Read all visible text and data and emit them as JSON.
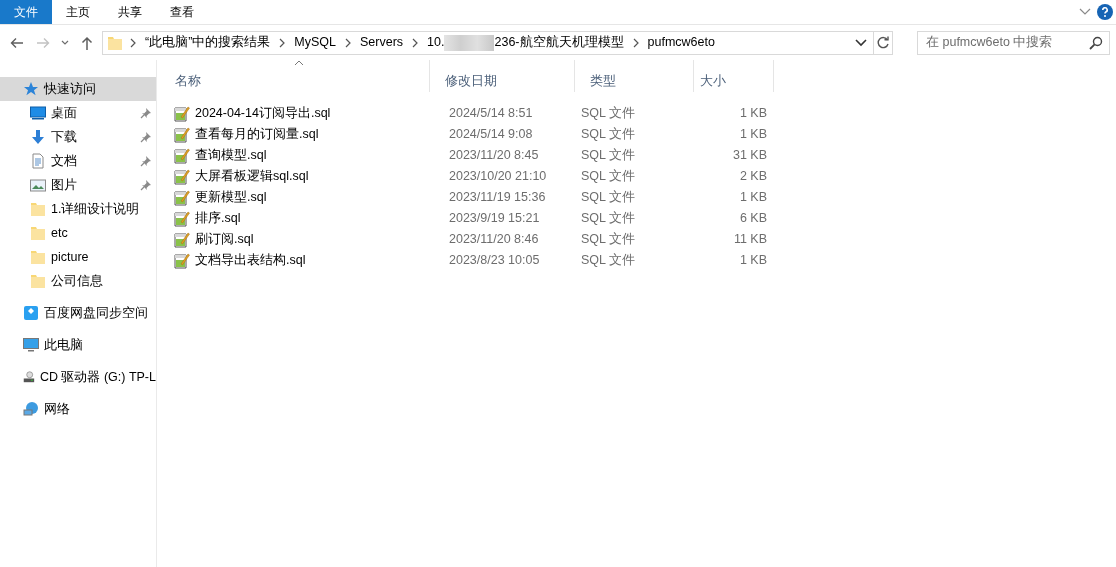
{
  "ribbon": {
    "tabs": [
      {
        "label": "文件",
        "selected": true
      },
      {
        "label": "主页",
        "selected": false
      },
      {
        "label": "共享",
        "selected": false
      },
      {
        "label": "查看",
        "selected": false
      }
    ]
  },
  "address_bar": {
    "segments": [
      {
        "text": "“此电脑”中的搜索结果"
      },
      {
        "text": "MySQL"
      },
      {
        "text": "Servers"
      },
      {
        "text": "10.",
        "redacted": true,
        "text_after": "236-航空航天机理模型"
      },
      {
        "text": "pufmcw6eto"
      }
    ],
    "search": {
      "placeholder": "在 pufmcw6eto 中搜索"
    }
  },
  "sidebar": {
    "items": [
      {
        "label": "快速访问",
        "kind": "quick",
        "selected": true,
        "children": [
          {
            "label": "桌面",
            "kind": "desktop",
            "pinned": true
          },
          {
            "label": "下载",
            "kind": "download",
            "pinned": true
          },
          {
            "label": "文档",
            "kind": "document",
            "pinned": true
          },
          {
            "label": "图片",
            "kind": "pictures",
            "pinned": true
          },
          {
            "label": "1.详细设计说明",
            "kind": "folder",
            "pinned": false
          },
          {
            "label": "etc",
            "kind": "folder",
            "pinned": false
          },
          {
            "label": "picture",
            "kind": "folder",
            "pinned": false
          },
          {
            "label": "公司信息",
            "kind": "folder",
            "pinned": false
          }
        ]
      },
      {
        "label": "百度网盘同步空间",
        "kind": "cloud",
        "selected": false
      },
      {
        "label": "此电脑",
        "kind": "pc",
        "selected": false
      },
      {
        "label": "CD 驱动器 (G:) TP-L",
        "kind": "drive",
        "selected": false
      },
      {
        "label": "网络",
        "kind": "network",
        "selected": false
      }
    ]
  },
  "table": {
    "columns": [
      {
        "label": "名称",
        "sorted": true
      },
      {
        "label": "修改日期",
        "sorted": false
      },
      {
        "label": "类型",
        "sorted": false
      },
      {
        "label": "大小",
        "sorted": false
      }
    ],
    "rows": [
      [
        "2024-04-14订阅导出.sql",
        "2024/5/14 8:51",
        "SQL 文件",
        "1 KB"
      ],
      [
        "查看每月的订阅量.sql",
        "2024/5/14 9:08",
        "SQL 文件",
        "1 KB"
      ],
      [
        "查询模型.sql",
        "2023/11/20 8:45",
        "SQL 文件",
        "31 KB"
      ],
      [
        "大屏看板逻辑sql.sql",
        "2023/10/20 21:10",
        "SQL 文件",
        "2 KB"
      ],
      [
        "更新模型.sql",
        "2023/11/19 15:36",
        "SQL 文件",
        "1 KB"
      ],
      [
        "排序.sql",
        "2023/9/19 15:21",
        "SQL 文件",
        "6 KB"
      ],
      [
        "刷订阅.sql",
        "2023/11/20 8:46",
        "SQL 文件",
        "11 KB"
      ],
      [
        "文档导出表结构.sql",
        "2023/8/23 10:05",
        "SQL 文件",
        "1 KB"
      ]
    ]
  }
}
